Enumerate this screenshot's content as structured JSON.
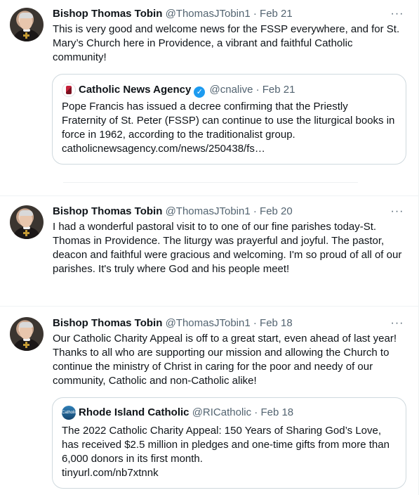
{
  "tweets": [
    {
      "author": "Bishop Thomas Tobin",
      "handle": "@ThomasJTobin1",
      "separator": "·",
      "date": "Feb 21",
      "more": "···",
      "text": "This is very good and welcome news for the FSSP everywhere, and for St. Mary’s Church here in Providence, a vibrant and faithful Catholic community!",
      "quote": {
        "source": "Catholic News Agency",
        "verified": "✓",
        "handle": "@cnalive",
        "separator": "·",
        "date": "Feb 21",
        "text": "Pope Francis has issued a decree confirming that the Priestly Fraternity of St. Peter (FSSP) can continue to use the liturgical books in force in 1962, according to the traditionalist group.",
        "link": "catholicnewsagency.com/news/250438/fs…"
      }
    },
    {
      "author": "Bishop Thomas Tobin",
      "handle": "@ThomasJTobin1",
      "separator": "·",
      "date": "Feb 20",
      "more": "···",
      "text": "I had a wonderful pastoral visit to to one of our fine parishes today-St. Thomas in Providence. The liturgy was prayerful and joyful. The pastor, deacon and faithful were gracious and welcoming. I'm so proud of all of our parishes. It's truly where God and his people meet!"
    },
    {
      "author": "Bishop Thomas Tobin",
      "handle": "@ThomasJTobin1",
      "separator": "·",
      "date": "Feb 18",
      "more": "···",
      "text": "Our Catholic Charity Appeal is off to a great start, even ahead of last year! Thanks to all who are supporting our mission and allowing the Church to continue the ministry of Christ in caring for the poor and needy of our community, Catholic and non-Catholic alike!",
      "quote": {
        "source": "Rhode Island Catholic",
        "logo_text": "Catholic",
        "handle": "@RICatholic",
        "separator": "·",
        "date": "Feb 18",
        "text": "The 2022 Catholic Charity Appeal: 150 Years of Sharing God’s Love, has received $2.5 million in pledges and one-time gifts from more than 6,000 donors in its first month.",
        "link": "tinyurl.com/nb7xtnnk"
      }
    }
  ],
  "colors": {
    "text": "#0f1419",
    "muted": "#536471",
    "border": "#cfd9de",
    "divider": "#eff3f4",
    "verified": "#1d9bf0"
  }
}
